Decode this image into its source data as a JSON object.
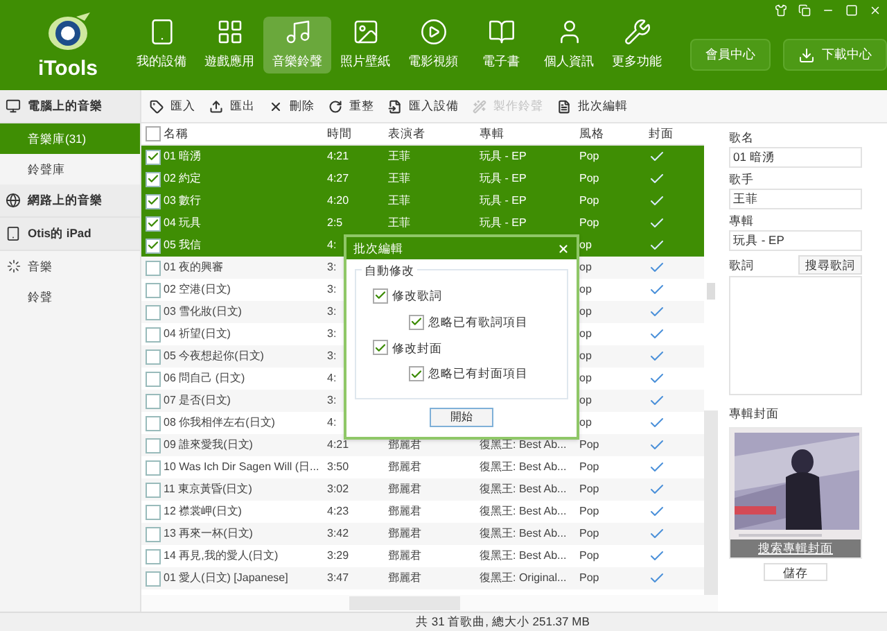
{
  "app": {
    "logo_text": "iTools"
  },
  "nav": [
    {
      "label": "我的設備",
      "selected": false
    },
    {
      "label": "遊戲應用",
      "selected": false
    },
    {
      "label": "音樂鈴聲",
      "selected": true
    },
    {
      "label": "照片壁紙",
      "selected": false
    },
    {
      "label": "電影視頻",
      "selected": false
    },
    {
      "label": "電子書",
      "selected": false
    },
    {
      "label": "個人資訊",
      "selected": false
    },
    {
      "label": "更多功能",
      "selected": false
    }
  ],
  "header_buttons": [
    {
      "label": "會員中心",
      "kind": "plain"
    },
    {
      "label": "下載中心",
      "kind": "download"
    }
  ],
  "sidebar": [
    {
      "label": "電腦上的音樂",
      "kind": "computer",
      "children": [
        {
          "label": "音樂庫(31)",
          "selected": true,
          "loading": false
        },
        {
          "label": "鈴聲庫",
          "selected": false,
          "loading": false
        }
      ]
    },
    {
      "label": "網路上的音樂",
      "kind": "web"
    },
    {
      "label": "Otis的 iPad",
      "kind": "device",
      "children": [
        {
          "label": "音樂",
          "selected": false,
          "loading": true
        },
        {
          "label": "鈴聲",
          "selected": false,
          "loading": false
        }
      ]
    }
  ],
  "toolbar": [
    {
      "label": "匯入",
      "disabled": false
    },
    {
      "label": "匯出",
      "disabled": false
    },
    {
      "label": "刪除",
      "disabled": false
    },
    {
      "label": "重整",
      "disabled": false
    },
    {
      "label": "匯入設備",
      "disabled": false
    },
    {
      "label": "製作鈴聲",
      "disabled": true
    },
    {
      "label": "批次編輯",
      "disabled": false
    }
  ],
  "table": {
    "all_checked": false,
    "columns": [
      "名稱",
      "時間",
      "表演者",
      "專輯",
      "風格",
      "封面"
    ],
    "rows": [
      {
        "name": "01 暗湧",
        "time": "4:21",
        "artist": "王菲",
        "album": "玩具 - EP",
        "genre": "Pop",
        "cover": true,
        "selected": true
      },
      {
        "name": "02 約定",
        "time": "4:27",
        "artist": "王菲",
        "album": "玩具 - EP",
        "genre": "Pop",
        "cover": true,
        "selected": true
      },
      {
        "name": "03 數行",
        "time": "4:20",
        "artist": "王菲",
        "album": "玩具 - EP",
        "genre": "Pop",
        "cover": true,
        "selected": true
      },
      {
        "name": "04 玩具",
        "time": "2:5",
        "artist": "王菲",
        "album": "玩具 - EP",
        "genre": "Pop",
        "cover": true,
        "selected": true
      },
      {
        "name": "05 我信",
        "time": "4:",
        "genre": "op",
        "cover": true,
        "selected": true
      },
      {
        "name": "01 夜的興審",
        "time": "3:",
        "genre": "op",
        "cover": true,
        "selected": false
      },
      {
        "name": "02 空港(日文)",
        "time": "3:",
        "genre": "op",
        "cover": true,
        "selected": false
      },
      {
        "name": "03 雪化妝(日文)",
        "time": "3:",
        "genre": "op",
        "cover": true,
        "selected": false
      },
      {
        "name": "04 祈望(日文)",
        "time": "3:",
        "genre": "op",
        "cover": true,
        "selected": false
      },
      {
        "name": "05 今夜想起你(日文)",
        "time": "3:",
        "genre": "op",
        "cover": true,
        "selected": false
      },
      {
        "name": "06 問自己 (日文)",
        "time": "4:",
        "genre": "op",
        "cover": true,
        "selected": false
      },
      {
        "name": "07 是否(日文)",
        "time": "3:",
        "genre": "op",
        "cover": true,
        "selected": false
      },
      {
        "name": "08 你我相伴左右(日文)",
        "time": "4:",
        "genre": "op",
        "cover": true,
        "selected": false
      },
      {
        "name": "09 誰來愛我(日文)",
        "time": "4:21",
        "artist": "鄧麗君",
        "album": "復黑王: Best Ab...",
        "genre": "Pop",
        "cover": true,
        "selected": false
      },
      {
        "name": "10 Was Ich Dir Sagen Will (日...",
        "time": "3:50",
        "artist": "鄧麗君",
        "album": "復黑王: Best Ab...",
        "genre": "Pop",
        "cover": true,
        "selected": false
      },
      {
        "name": "11 東京黃昏(日文)",
        "time": "3:02",
        "artist": "鄧麗君",
        "album": "復黑王: Best Ab...",
        "genre": "Pop",
        "cover": true,
        "selected": false
      },
      {
        "name": "12 襟裳岬(日文)",
        "time": "4:23",
        "artist": "鄧麗君",
        "album": "復黑王: Best Ab...",
        "genre": "Pop",
        "cover": true,
        "selected": false
      },
      {
        "name": "13 再來一杯(日文)",
        "time": "3:42",
        "artist": "鄧麗君",
        "album": "復黑王: Best Ab...",
        "genre": "Pop",
        "cover": true,
        "selected": false
      },
      {
        "name": "14 再見,我的愛人(日文)",
        "time": "3:29",
        "artist": "鄧麗君",
        "album": "復黑王: Best Ab...",
        "genre": "Pop",
        "cover": true,
        "selected": false
      },
      {
        "name": "01 愛人(日文) [Japanese]",
        "time": "3:47",
        "artist": "鄧麗君",
        "album": "復黑王: Original...",
        "genre": "Pop",
        "cover": true,
        "selected": false
      }
    ]
  },
  "dialog": {
    "title": "批次編輯",
    "group_title": "自動修改",
    "options": [
      {
        "label": "修改歌詞",
        "checked": true,
        "children": [
          {
            "label": "忽略已有歌詞項目",
            "checked": true
          }
        ]
      },
      {
        "label": "修改封面",
        "checked": true,
        "children": [
          {
            "label": "忽略已有封面項目",
            "checked": true
          }
        ]
      }
    ],
    "button": "開始"
  },
  "details": {
    "fields": [
      {
        "label": "歌名",
        "value": "01 暗湧"
      },
      {
        "label": "歌手",
        "value": "王菲"
      },
      {
        "label": "專輯",
        "value": "玩具 - EP"
      }
    ],
    "lyrics_label": "歌詞",
    "lyrics_button": "搜尋歌詞",
    "cover_label": "專輯封面",
    "cover_button": "搜索專輯封面",
    "save_button": "儲存"
  },
  "status_bar": "共 31 首歌曲, 總大小 251.37 MB"
}
